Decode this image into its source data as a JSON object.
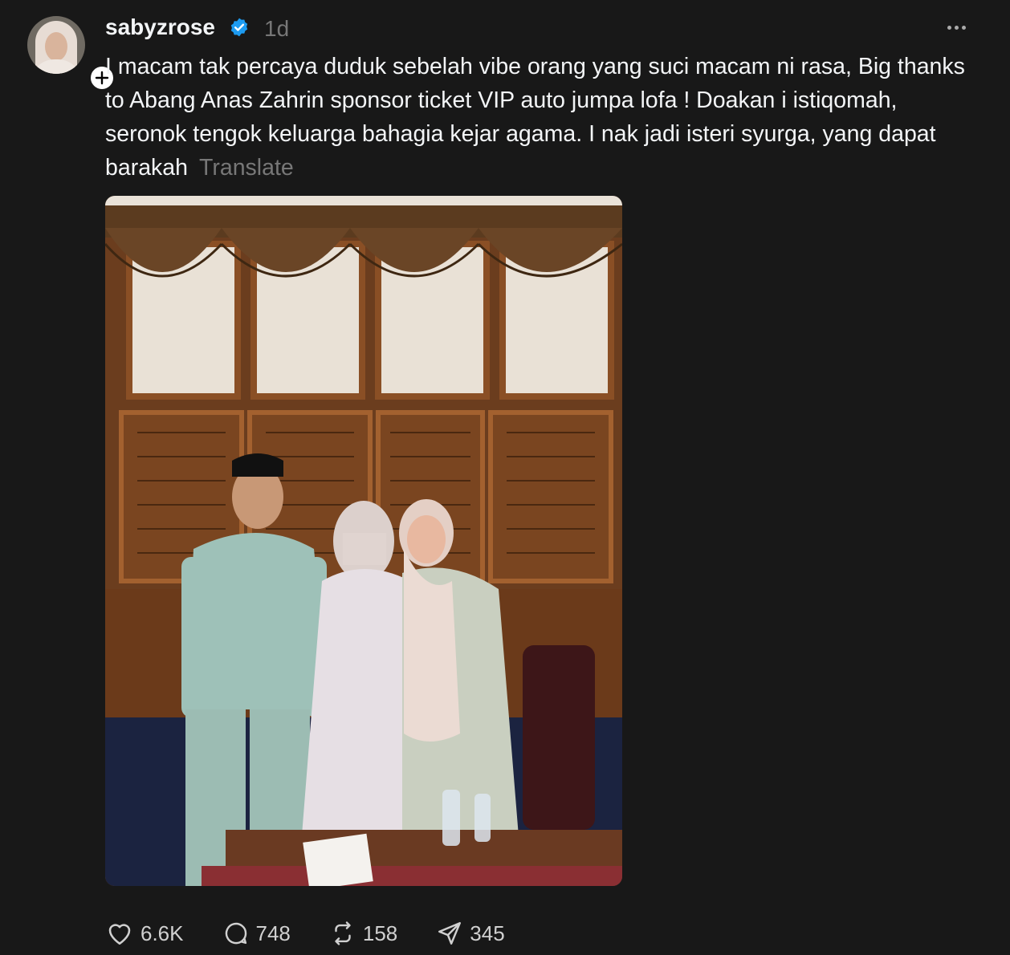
{
  "post": {
    "username": "sabyzrose",
    "time": "1d",
    "text": "I macam tak percaya duduk sebelah vibe orang yang suci macam ni rasa, Big thanks to Abang Anas Zahrin sponsor ticket VIP auto jumpa lofa ! Doakan i istiqomah, seronok tengok keluarga bahagia kejar agama. I nak jadi isteri syurga, yang dapat barakah",
    "translate_label": "Translate"
  },
  "actions": {
    "likes": "6.6K",
    "replies": "748",
    "reposts": "158",
    "shares": "345"
  },
  "colors": {
    "background": "#181818",
    "text": "#f3f5f7",
    "muted": "#777777",
    "verified": "#1d9bf0"
  },
  "icons": [
    "plus-icon",
    "verified-badge-icon",
    "more-options-icon",
    "heart-icon",
    "reply-icon",
    "repost-icon",
    "share-icon"
  ]
}
